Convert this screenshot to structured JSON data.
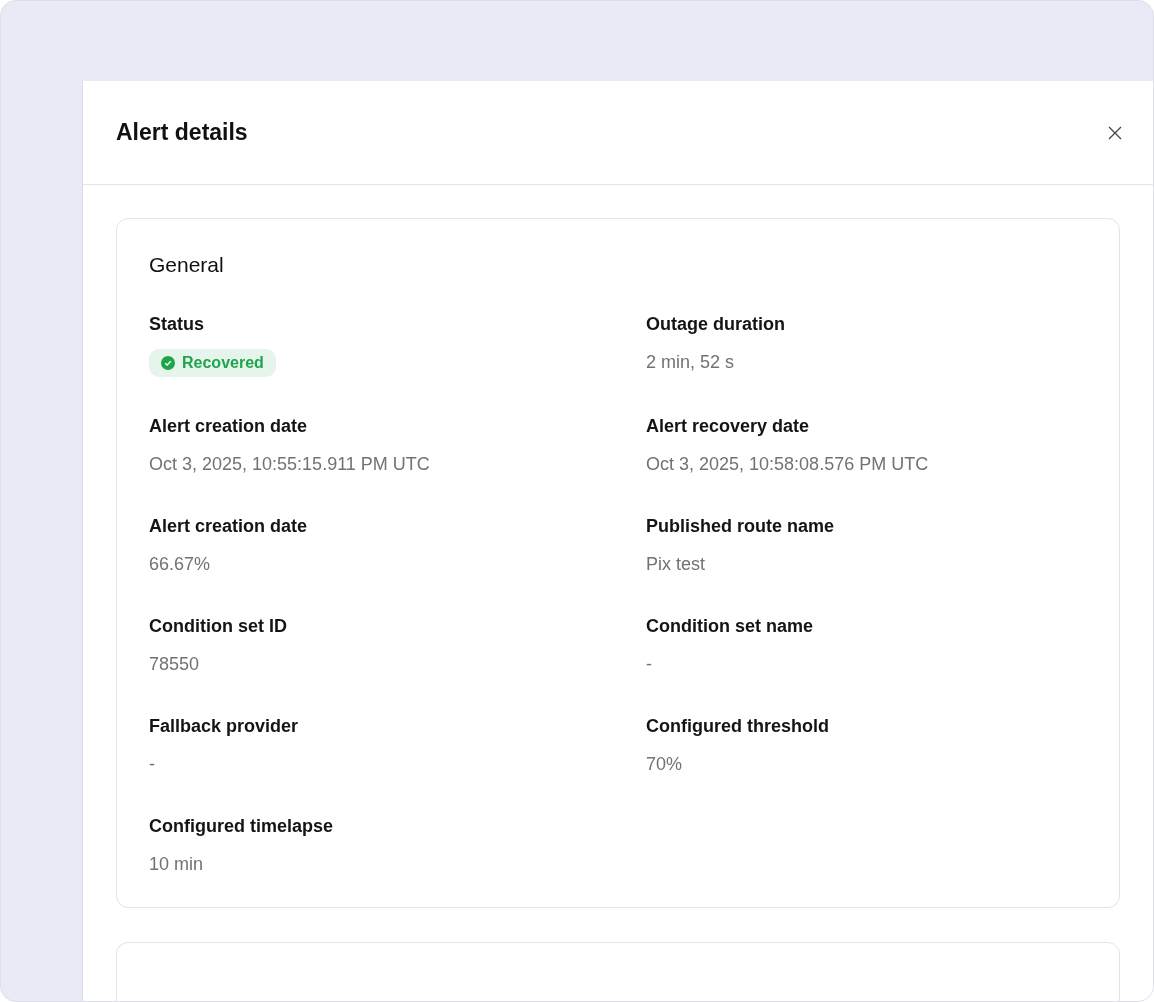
{
  "panel": {
    "title": "Alert details"
  },
  "general": {
    "heading": "General",
    "fields": [
      {
        "kind": "status",
        "label": "Status",
        "value": "Recovered",
        "color": "#1ea54c"
      },
      {
        "kind": "text",
        "label": "Outage duration",
        "value": "2 min, 52 s"
      },
      {
        "kind": "text",
        "label": "Alert creation date",
        "value": "Oct 3, 2025, 10:55:15.911 PM UTC"
      },
      {
        "kind": "text",
        "label": "Alert recovery date",
        "value": "Oct 3, 2025, 10:58:08.576 PM UTC"
      },
      {
        "kind": "text",
        "label": "Alert creation date",
        "value": "66.67%"
      },
      {
        "kind": "text",
        "label": "Published route name",
        "value": "Pix test"
      },
      {
        "kind": "text",
        "label": "Condition set ID",
        "value": "78550"
      },
      {
        "kind": "text",
        "label": "Condition set name",
        "value": "-"
      },
      {
        "kind": "text",
        "label": "Fallback provider",
        "value": "-"
      },
      {
        "kind": "text",
        "label": "Configured threshold",
        "value": "70%"
      },
      {
        "kind": "text",
        "label": "Configured timelapse",
        "value": "10 min"
      }
    ]
  }
}
